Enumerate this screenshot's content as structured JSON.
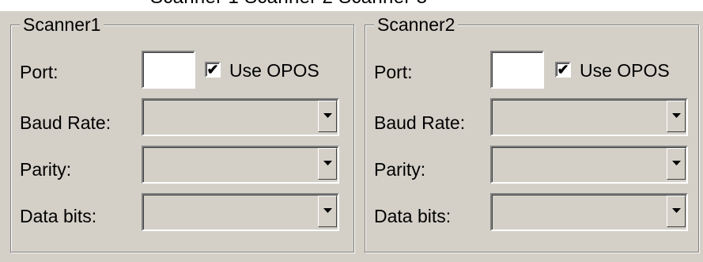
{
  "header_partial_text": "Scanner 1 Scanner 2 Scanner 3",
  "scanners": [
    {
      "title": "Scanner1",
      "port_label": "Port:",
      "port_value": "",
      "use_opos_label": "Use OPOS",
      "use_opos_checked": true,
      "baud_rate_label": "Baud Rate:",
      "baud_rate_value": "",
      "parity_label": "Parity:",
      "parity_value": "",
      "data_bits_label": "Data bits:",
      "data_bits_value": ""
    },
    {
      "title": "Scanner2",
      "port_label": "Port:",
      "port_value": "",
      "use_opos_label": "Use OPOS",
      "use_opos_checked": true,
      "baud_rate_label": "Baud Rate:",
      "baud_rate_value": "",
      "parity_label": "Parity:",
      "parity_value": "",
      "data_bits_label": "Data bits:",
      "data_bits_value": ""
    }
  ],
  "icons": {
    "checkbox_mark": "check-mark-icon",
    "dropdown": "chevron-down-icon"
  },
  "colors": {
    "face": "#d4d0c8",
    "shadow": "#808080",
    "highlight": "#ffffff",
    "field": "#ffffff"
  }
}
